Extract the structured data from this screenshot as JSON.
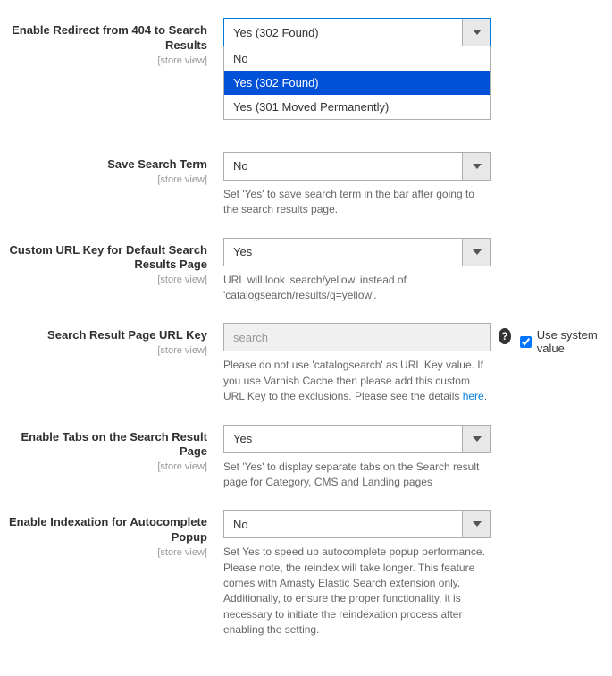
{
  "scope_label": "[store view]",
  "fields": {
    "redirect_404": {
      "label": "Enable Redirect from 404 to Search Results",
      "value": "Yes (302 Found)",
      "options": [
        "No",
        "Yes (302 Found)",
        "Yes (301 Moved Permanently)"
      ]
    },
    "save_term": {
      "label": "Save Search Term",
      "value": "No",
      "helper": "Set 'Yes' to save search term in the bar after going to the search results page."
    },
    "custom_url_key": {
      "label": "Custom URL Key for Default Search Results Page",
      "value": "Yes",
      "helper": "URL will look 'search/yellow' instead of 'catalogsearch/results/q=yellow'."
    },
    "url_key": {
      "label": "Search Result Page URL Key",
      "placeholder": "search",
      "helper_pre": "Please do not use 'catalogsearch' as URL Key value. If you use Varnish Cache then please add this custom URL Key to the exclusions. Please see the details ",
      "helper_link": "here",
      "helper_post": ".",
      "use_system": "Use system value"
    },
    "enable_tabs": {
      "label": "Enable Tabs on the Search Result Page",
      "value": "Yes",
      "helper": "Set 'Yes' to display separate tabs on the Search result page for Category, CMS and Landing pages"
    },
    "enable_index": {
      "label": "Enable Indexation for Autocomplete Popup",
      "value": "No",
      "helper": "Set Yes to speed up autocomplete popup performance. Please note, the reindex will take longer. This feature comes with Amasty Elastic Search extension only. Additionally, to ensure the proper functionality, it is necessary to initiate the reindexation process after enabling the setting."
    }
  }
}
